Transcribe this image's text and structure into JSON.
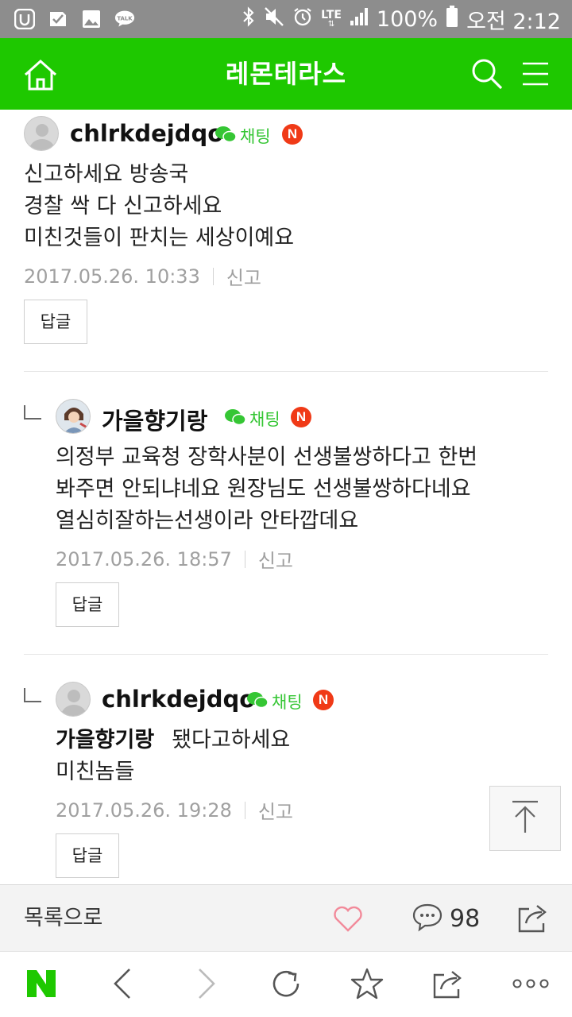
{
  "status_bar": {
    "battery": "100%",
    "network": "LTE",
    "time": "오전 2:12",
    "talk_label": "TALK"
  },
  "header": {
    "title": "레몬테라스"
  },
  "comments": [
    {
      "nickname": "chlrkdejdqo",
      "chat_label": "채팅",
      "badge": "N",
      "lines": [
        "신고하세요 방송국",
        "경찰 싹 다 신고하세요",
        "미친것들이 판치는 세상이예요"
      ],
      "date": "2017.05.26. 10:33",
      "report_label": "신고",
      "reply_label": "답글",
      "is_reply": false
    },
    {
      "nickname": "가을향기랑",
      "chat_label": "채팅",
      "badge": "N",
      "lines": [
        "의정부 교육청 장학사분이 선생불쌍하다고 한번",
        "봐주면 안되냐네요 원장님도 선생불쌍하다네요",
        "열심히잘하는선생이라 안타깝데요"
      ],
      "date": "2017.05.26. 18:57",
      "report_label": "신고",
      "reply_label": "답글",
      "is_reply": true
    },
    {
      "nickname": "chlrkdejdqo",
      "chat_label": "채팅",
      "badge": "N",
      "mention": "가을향기랑",
      "lines": [
        "됐다고하세요",
        "미친놈들"
      ],
      "date": "2017.05.26. 19:28",
      "report_label": "신고",
      "reply_label": "답글",
      "is_reply": true
    }
  ],
  "action_bar": {
    "back_to_list": "목록으로",
    "comment_count": "98"
  },
  "browser_bar": {
    "naver_logo": "N"
  },
  "colors": {
    "brand_green": "#1ec800",
    "chat_green": "#35c634",
    "badge_red": "#f03a17",
    "status_bar": "#8d8d8d"
  }
}
